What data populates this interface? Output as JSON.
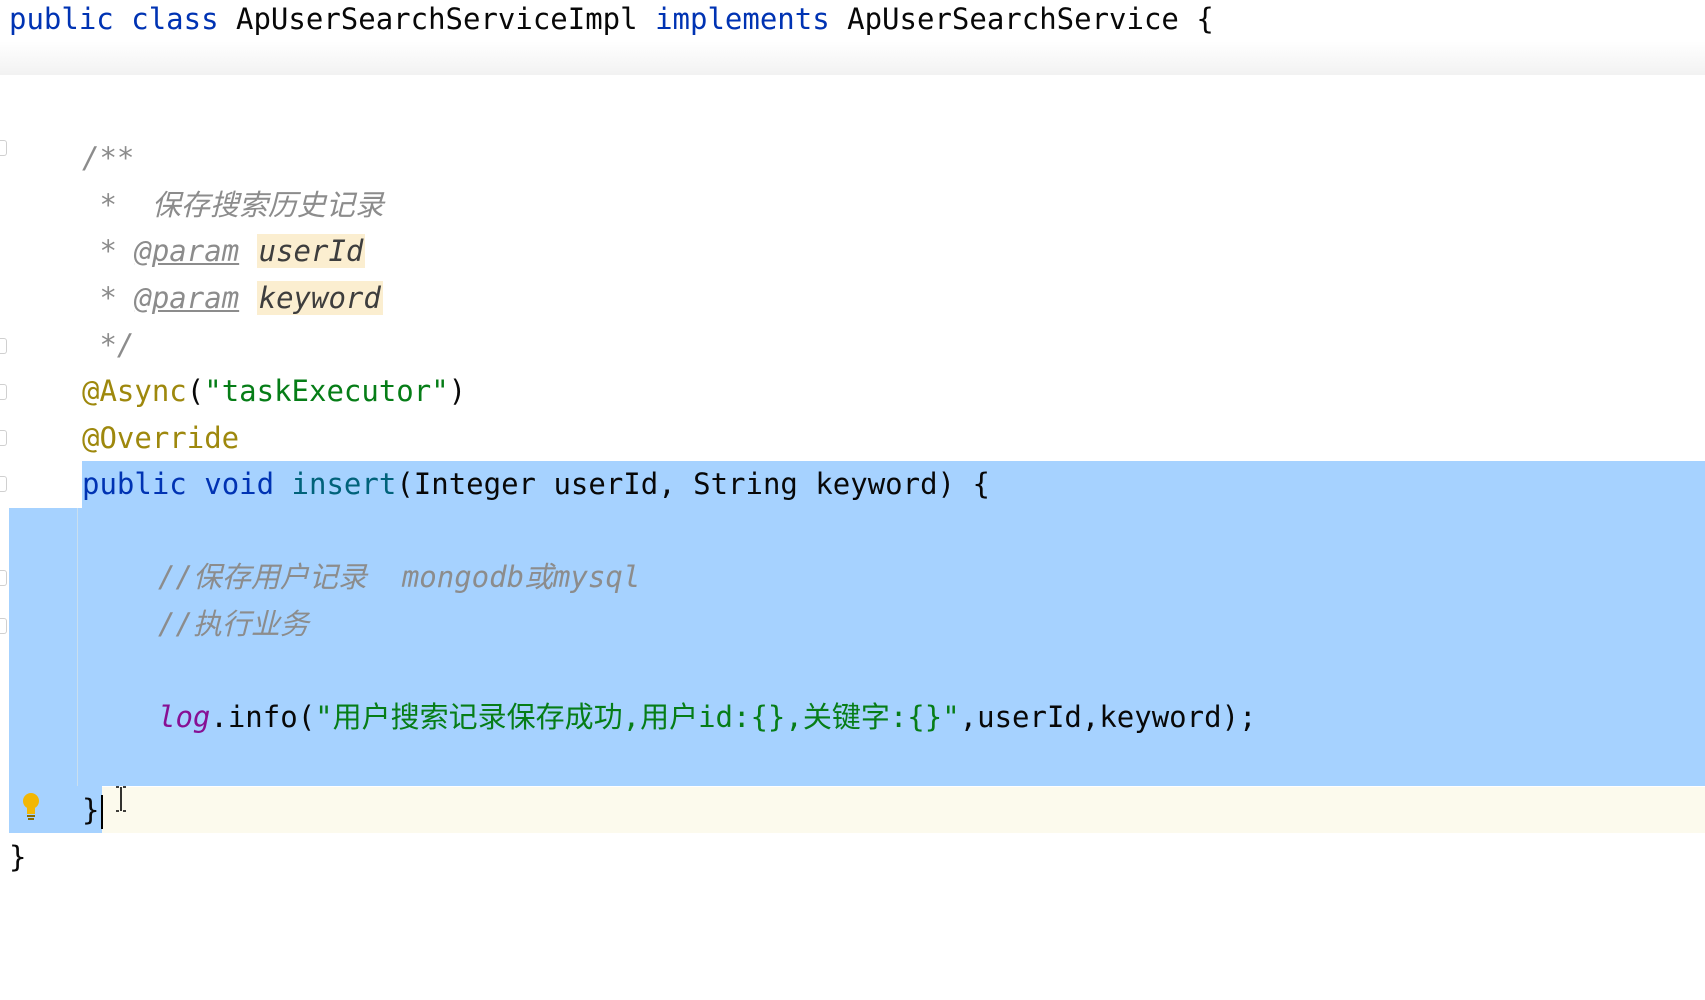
{
  "editor": {
    "header": {
      "kw1": "public",
      "kw2": "class",
      "class_name": "ApUserSearchServiceImpl",
      "kw3": "implements",
      "interface_name": "ApUserSearchService",
      "brace": "{"
    },
    "javadoc": {
      "open": "/**",
      "description": " *  保存搜索历史记录",
      "star": " * ",
      "param_tag": "@param",
      "param1": "userId",
      "param2": "keyword",
      "close": " */"
    },
    "annotations": {
      "async": "@Async",
      "async_open": "(",
      "async_arg": "\"taskExecutor\"",
      "async_close": ")",
      "override": "@Override"
    },
    "method": {
      "kw_public": "public",
      "kw_void": "void",
      "name": "insert",
      "params": "(Integer userId, String keyword) {",
      "comment1": "//保存用户记录  mongodb或mysql",
      "comment2": "//执行业务",
      "log_field": "log",
      "log_call": ".info(",
      "log_string": "\"用户搜索记录保存成功,用户id:{},关键字:{}\"",
      "log_args": ",userId,keyword);",
      "close_brace": "}"
    },
    "class_close": "}"
  },
  "colors": {
    "keyword": "#0033b3",
    "annotation": "#9e880d",
    "string": "#067d17",
    "method_name": "#00627a",
    "comment": "#8c8c8c",
    "field": "#871094",
    "selection": "#a6d2ff",
    "current_line": "#fcfaed",
    "param_highlight": "#fbeed0"
  },
  "icons": {
    "intention_bulb": "lightbulb-icon",
    "mouse_cursor": "text-cursor-icon"
  }
}
